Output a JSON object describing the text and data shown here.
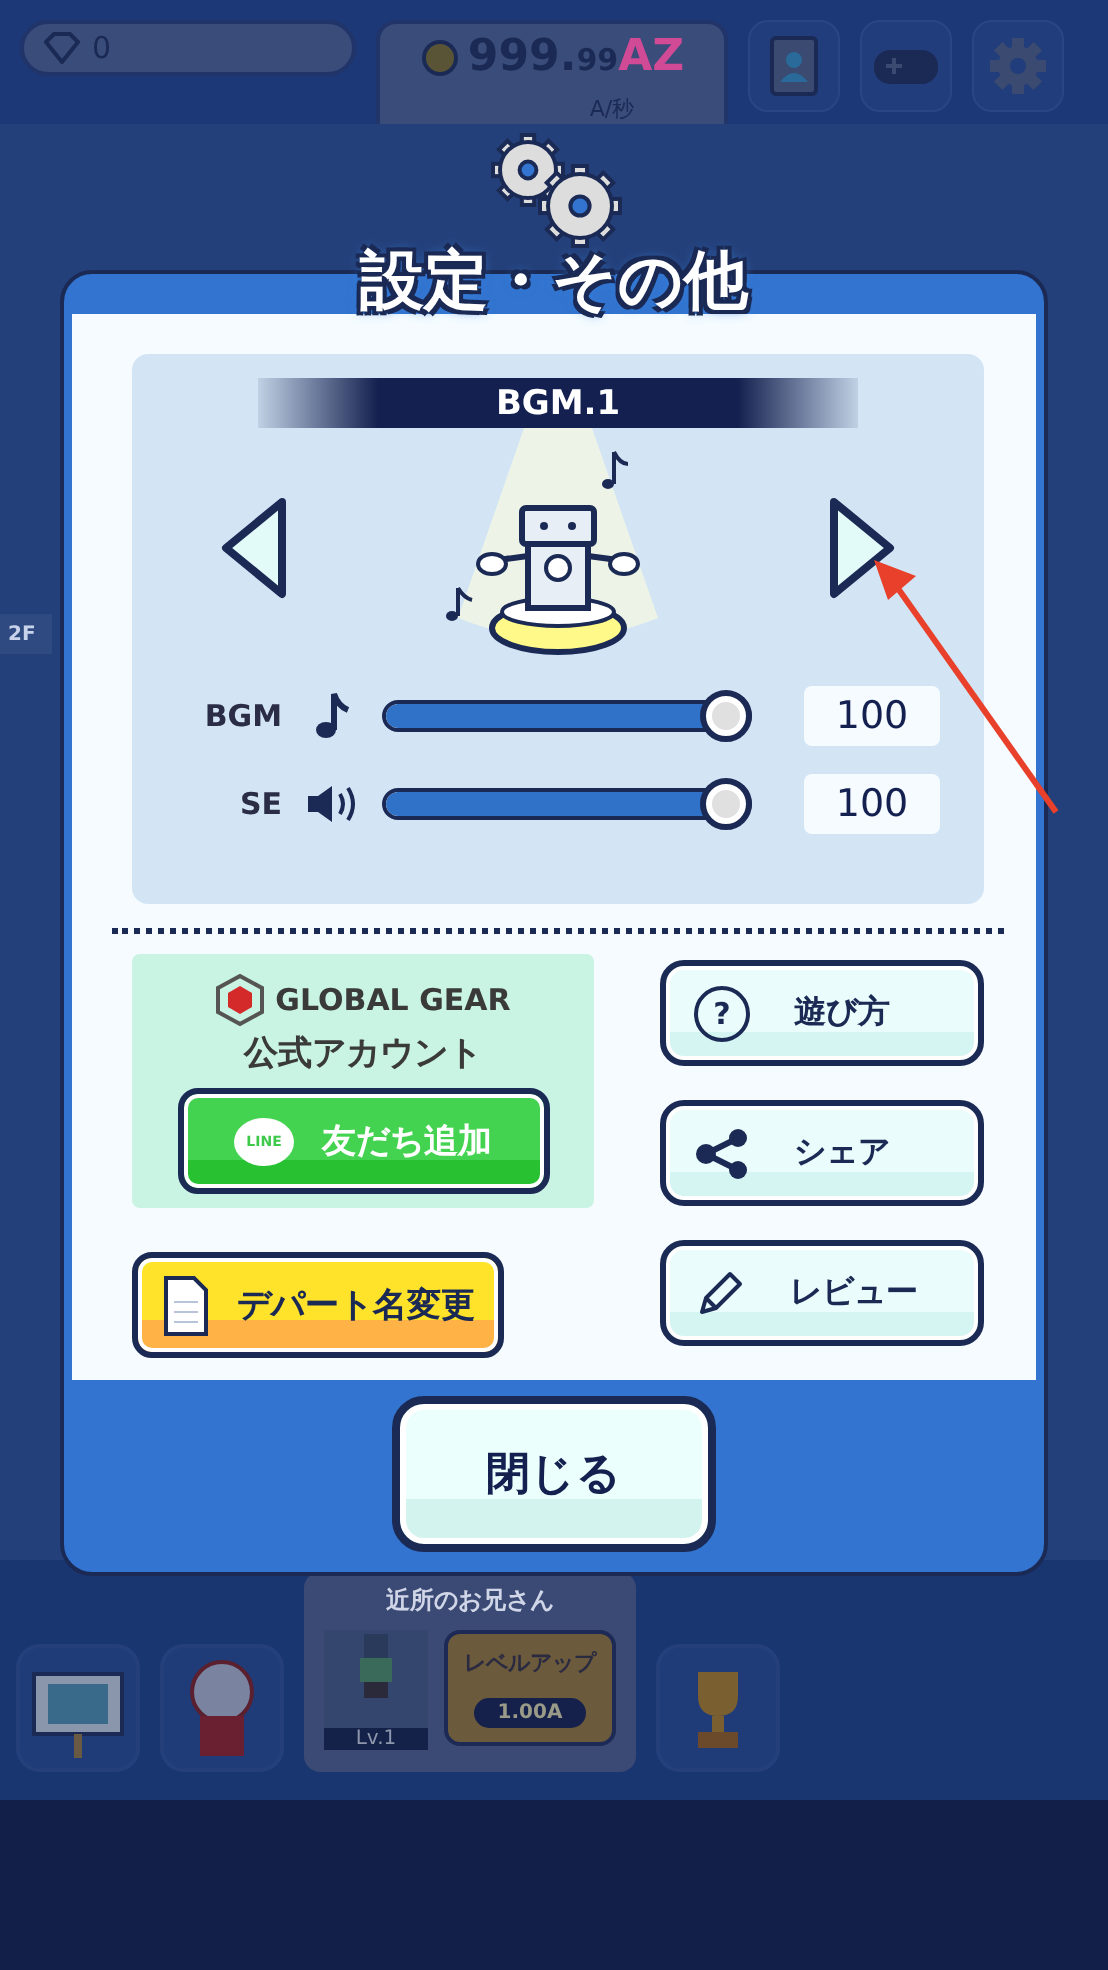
{
  "hud": {
    "gems": "0",
    "money": {
      "whole": "999.",
      "fraction": "99",
      "unit": "AZ"
    },
    "rate": "A/秒"
  },
  "floor_label": "2F",
  "dialog": {
    "title": "設定・その他",
    "track": {
      "title": "BGM.1"
    },
    "sliders": [
      {
        "kind": "music",
        "label": "BGM",
        "level": 1,
        "value": "100"
      },
      {
        "kind": "sound",
        "label": "SE",
        "level": 1,
        "value": "100"
      }
    ],
    "official": {
      "brand": "GLOBAL GEAR",
      "caption": "公式アカウント",
      "badge": "LINE",
      "button": "友だち追加"
    },
    "rename_button": "デパート名変更",
    "side_buttons": [
      {
        "kind": "help",
        "icon_text": "?",
        "label": "遊び方"
      },
      {
        "kind": "share",
        "label": "シェア"
      },
      {
        "kind": "review",
        "label": "レビュー"
      }
    ],
    "close_button": "閉じる"
  },
  "bottom_bar": {
    "character": {
      "name": "近所のお兄さん",
      "level": "Lv.1",
      "action": "レベルアップ",
      "cost": "1.00A"
    }
  }
}
